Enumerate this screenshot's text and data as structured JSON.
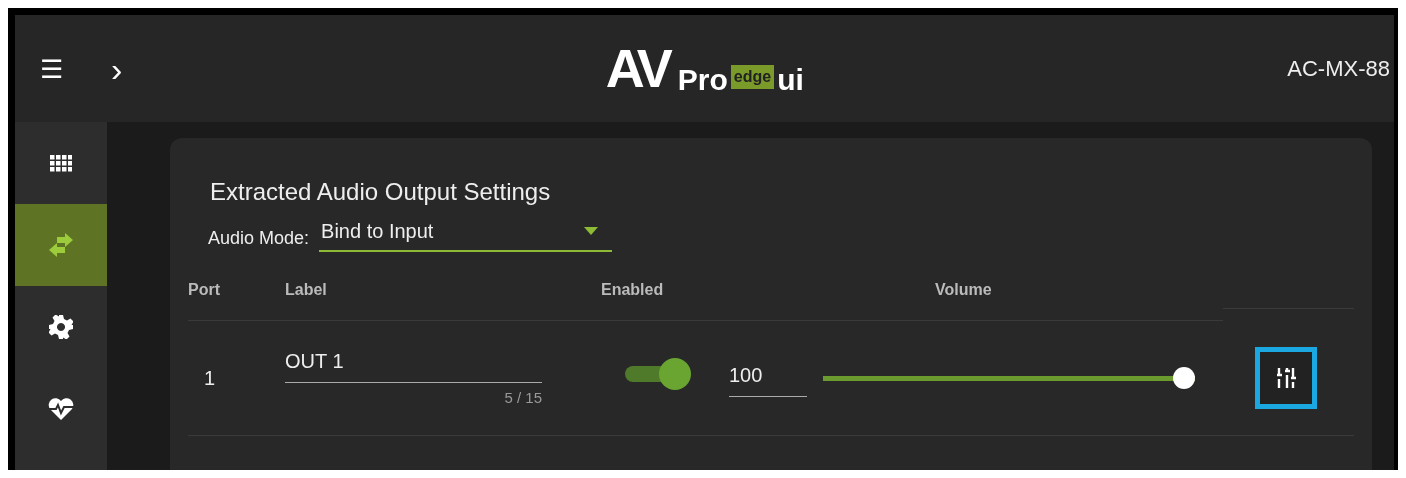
{
  "header": {
    "menu_icon": "☰",
    "expand_icon": "›",
    "logo": {
      "av": "AV",
      "pro": "Pro",
      "edge": "edge",
      "ui": "ui"
    },
    "device": "AC-MX-88"
  },
  "sidebar": {
    "items": [
      {
        "kind": "grid",
        "selected": false
      },
      {
        "kind": "arrows",
        "selected": true
      },
      {
        "kind": "gear",
        "selected": false
      },
      {
        "kind": "heart",
        "selected": false
      }
    ]
  },
  "panel": {
    "title": "Extracted Audio Output Settings",
    "audio_mode": {
      "label": "Audio Mode:",
      "value": "Bind to Input"
    },
    "table": {
      "columns": [
        "Port",
        "Label",
        "Enabled",
        "Volume"
      ],
      "rows": [
        {
          "port": "1",
          "label": "OUT 1",
          "counter": "5 / 15",
          "enabled": true,
          "volume": "100",
          "level": 1.0,
          "eq_highlighted": true
        }
      ]
    }
  }
}
